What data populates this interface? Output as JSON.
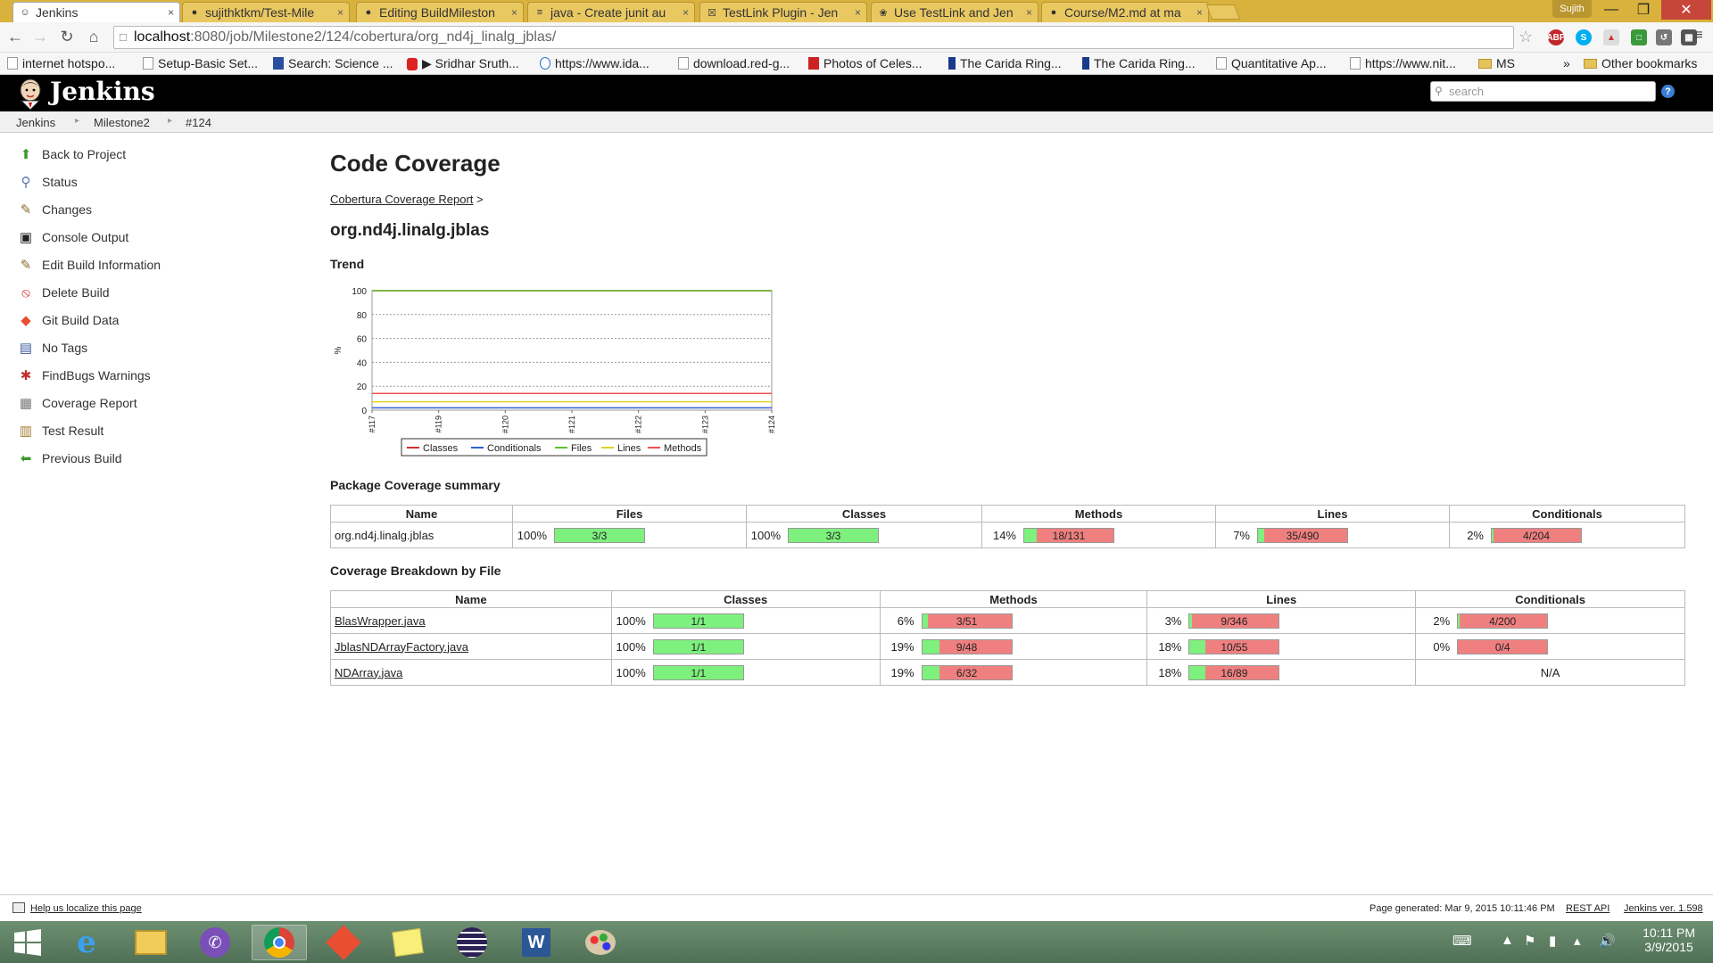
{
  "browser": {
    "tabs": [
      {
        "title": "Jenkins",
        "icon": "jenkins-icon",
        "active": true
      },
      {
        "title": "sujithktkm/Test-Mile",
        "icon": "github-icon"
      },
      {
        "title": "Editing BuildMileston",
        "icon": "github-icon"
      },
      {
        "title": "java - Create junit au",
        "icon": "stackoverflow-icon"
      },
      {
        "title": "TestLink Plugin - Jen",
        "icon": "testlink-icon"
      },
      {
        "title": "Use TestLink and Jen",
        "icon": "page-icon"
      },
      {
        "title": "Course/M2.md at ma",
        "icon": "github-icon"
      }
    ],
    "user": "Sujith",
    "url_host": "localhost",
    "url_rest": ":8080/job/Milestone2/124/cobertura/org_nd4j_linalg_jblas/",
    "bookmarks": [
      "internet hotspo...",
      "Setup-Basic Set...",
      "Search: Science ...",
      "▶ Sridhar Sruth...",
      "https://www.ida...",
      "download.red-g...",
      "Photos of Celes...",
      "The Carida Ring...",
      "The Carida Ring...",
      "Quantitative Ap...",
      "https://www.nit...",
      "MS"
    ],
    "bookmarks_more": "»",
    "other_bookmarks": "Other bookmarks"
  },
  "jenkins": {
    "title": "Jenkins",
    "search_placeholder": "search",
    "breadcrumbs": [
      "Jenkins",
      "Milestone2",
      "#124"
    ],
    "tasks": [
      {
        "label": "Back to Project",
        "icon": "up-arrow-icon"
      },
      {
        "label": "Status",
        "icon": "magnifier-icon"
      },
      {
        "label": "Changes",
        "icon": "notepad-icon"
      },
      {
        "label": "Console Output",
        "icon": "terminal-icon"
      },
      {
        "label": "Edit Build Information",
        "icon": "notepad-icon"
      },
      {
        "label": "Delete Build",
        "icon": "no-entry-icon"
      },
      {
        "label": "Git Build Data",
        "icon": "git-icon"
      },
      {
        "label": "No Tags",
        "icon": "floppy-icon"
      },
      {
        "label": "FindBugs Warnings",
        "icon": "bug-icon"
      },
      {
        "label": "Coverage Report",
        "icon": "coverage-icon"
      },
      {
        "label": "Test Result",
        "icon": "clipboard-icon"
      },
      {
        "label": "Previous Build",
        "icon": "left-arrow-icon"
      }
    ],
    "page_title": "Code Coverage",
    "report_link": "Cobertura Coverage Report",
    "report_sep": ">",
    "package_name": "org.nd4j.linalg.jblas",
    "trend_heading": "Trend",
    "summary_heading": "Package Coverage summary",
    "breakdown_heading": "Coverage Breakdown by File",
    "summary_columns": [
      "Name",
      "Files",
      "Classes",
      "Methods",
      "Lines",
      "Conditionals"
    ],
    "summary_rows": [
      {
        "name": "org.nd4j.linalg.jblas",
        "cells": [
          {
            "pct": "100%",
            "ratio": "3/3",
            "fraction": 1.0
          },
          {
            "pct": "100%",
            "ratio": "3/3",
            "fraction": 1.0
          },
          {
            "pct": "14%",
            "ratio": "18/131",
            "fraction": 0.14
          },
          {
            "pct": "7%",
            "ratio": "35/490",
            "fraction": 0.07
          },
          {
            "pct": "2%",
            "ratio": "4/204",
            "fraction": 0.02
          }
        ]
      }
    ],
    "breakdown_columns": [
      "Name",
      "Classes",
      "Methods",
      "Lines",
      "Conditionals"
    ],
    "breakdown_rows": [
      {
        "name": "BlasWrapper.java",
        "cells": [
          {
            "pct": "100%",
            "ratio": "1/1",
            "fraction": 1.0
          },
          {
            "pct": "6%",
            "ratio": "3/51",
            "fraction": 0.06
          },
          {
            "pct": "3%",
            "ratio": "9/346",
            "fraction": 0.03
          },
          {
            "pct": "2%",
            "ratio": "4/200",
            "fraction": 0.02
          }
        ]
      },
      {
        "name": "JblasNDArrayFactory.java",
        "cells": [
          {
            "pct": "100%",
            "ratio": "1/1",
            "fraction": 1.0
          },
          {
            "pct": "19%",
            "ratio": "9/48",
            "fraction": 0.19
          },
          {
            "pct": "18%",
            "ratio": "10/55",
            "fraction": 0.18
          },
          {
            "pct": "0%",
            "ratio": "0/4",
            "fraction": 0.0
          }
        ]
      },
      {
        "name": "NDArray.java",
        "cells": [
          {
            "pct": "100%",
            "ratio": "1/1",
            "fraction": 1.0
          },
          {
            "pct": "19%",
            "ratio": "6/32",
            "fraction": 0.19
          },
          {
            "pct": "18%",
            "ratio": "16/89",
            "fraction": 0.18
          },
          {
            "na": "N/A"
          }
        ]
      }
    ],
    "footer": {
      "localize": "Help us localize this page",
      "generated": "Page generated: Mar 9, 2015 10:11:46 PM",
      "rest_api": "REST API",
      "version": "Jenkins ver. 1.598"
    }
  },
  "chart_data": {
    "type": "line",
    "x": [
      "#117",
      "#119",
      "#120",
      "#121",
      "#122",
      "#123",
      "#124"
    ],
    "ylabel": "%",
    "ylim": [
      0,
      100
    ],
    "yticks": [
      0,
      20,
      40,
      60,
      80,
      100
    ],
    "grid": true,
    "legend": "bottom",
    "series": [
      {
        "name": "Classes",
        "color": "#d03030",
        "values": [
          100,
          100,
          100,
          100,
          100,
          100,
          100
        ]
      },
      {
        "name": "Conditionals",
        "color": "#3060d0",
        "values": [
          2,
          2,
          2,
          2,
          2,
          2,
          2
        ]
      },
      {
        "name": "Files",
        "color": "#60c030",
        "values": [
          100,
          100,
          100,
          100,
          100,
          100,
          100
        ]
      },
      {
        "name": "Lines",
        "color": "#e0d020",
        "values": [
          7,
          7,
          7,
          7,
          7,
          7,
          7
        ]
      },
      {
        "name": "Methods",
        "color": "#f05050",
        "values": [
          14,
          14,
          14,
          14,
          14,
          14,
          14
        ]
      }
    ]
  },
  "taskbar": {
    "apps": [
      "windows-start-icon",
      "internet-explorer-icon",
      "file-explorer-icon",
      "viber-icon",
      "chrome-icon",
      "git-gui-icon",
      "sticky-notes-icon",
      "eclipse-icon",
      "word-icon",
      "paint-icon"
    ],
    "time": "10:11 PM",
    "date": "3/9/2015"
  },
  "colors": {
    "covered": "#7ef07e",
    "uncovered": "#f08080",
    "header_bg": "#000000"
  }
}
